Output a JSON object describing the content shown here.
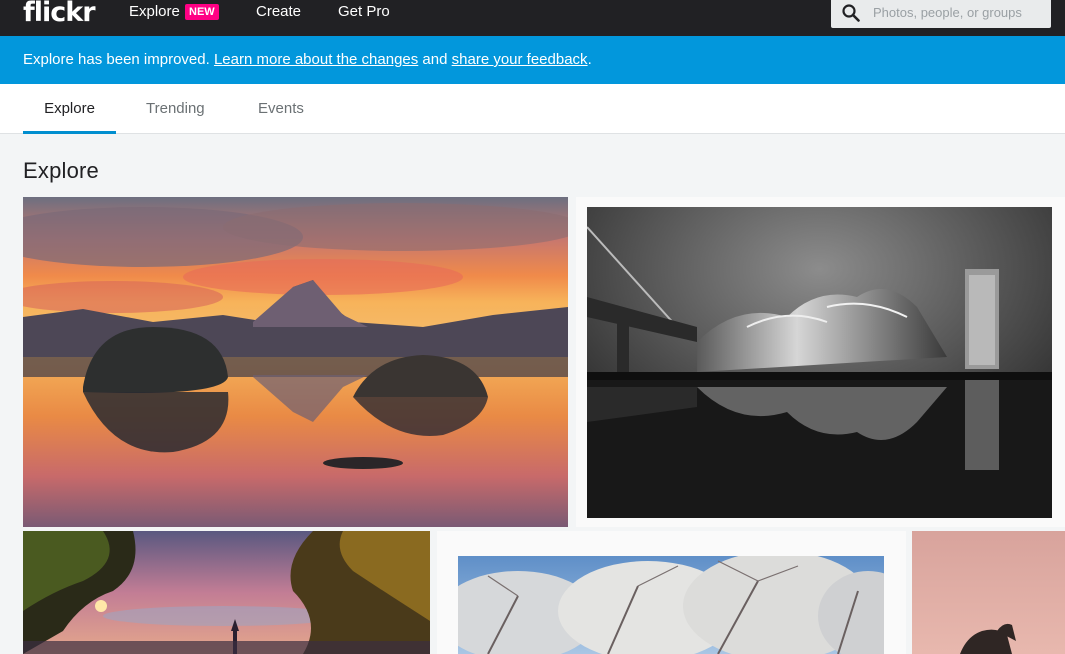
{
  "topnav": {
    "logo": "flickr",
    "explore_label": "Explore",
    "new_badge": "NEW",
    "create_label": "Create",
    "getpro_label": "Get Pro",
    "search_placeholder": "Photos, people, or groups"
  },
  "banner": {
    "text_before": "Explore has been improved. ",
    "link1": "Learn more about the changes",
    "text_mid": " and ",
    "link2": "share your feedback",
    "text_after": "."
  },
  "tabs": [
    {
      "label": "Explore",
      "active": true
    },
    {
      "label": "Trending",
      "active": false
    },
    {
      "label": "Events",
      "active": false
    }
  ],
  "page_title": "Explore",
  "colors": {
    "nav_bg": "#212124",
    "banner_bg": "#0297dc",
    "badge": "#ff0084",
    "tab_underline": "#008ecf"
  },
  "icons": {
    "search": "search-icon"
  }
}
